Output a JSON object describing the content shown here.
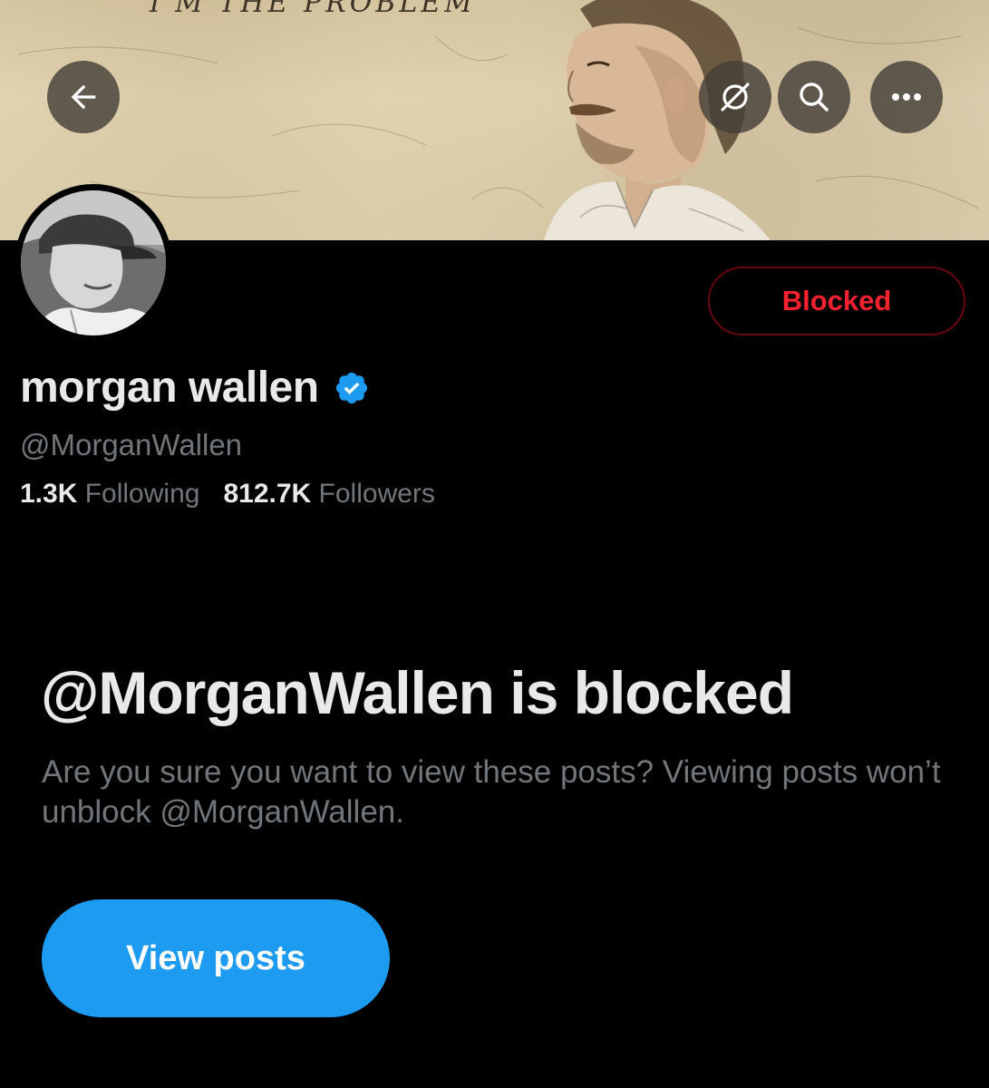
{
  "banner": {
    "title_text": "I'M THE PROBLEM"
  },
  "header": {
    "back_icon": "arrow-left-icon",
    "grok_icon": "grok-icon",
    "search_icon": "search-icon",
    "more_icon": "more-horizontal-icon"
  },
  "profile": {
    "display_name": "morgan wallen",
    "handle": "@MorganWallen",
    "verified": true,
    "verified_color": "#1d9bf0",
    "following_count": "1.3K",
    "following_label": "Following",
    "followers_count": "812.7K",
    "followers_label": "Followers"
  },
  "actions": {
    "blocked_label": "Blocked",
    "blocked_color": "#f4212e"
  },
  "blocked_notice": {
    "title": "@MorganWallen is blocked",
    "description": "Are you sure you want to view these posts? Viewing posts won’t unblock @MorganWallen.",
    "view_posts_label": "View posts",
    "button_color": "#1d9bf0"
  }
}
